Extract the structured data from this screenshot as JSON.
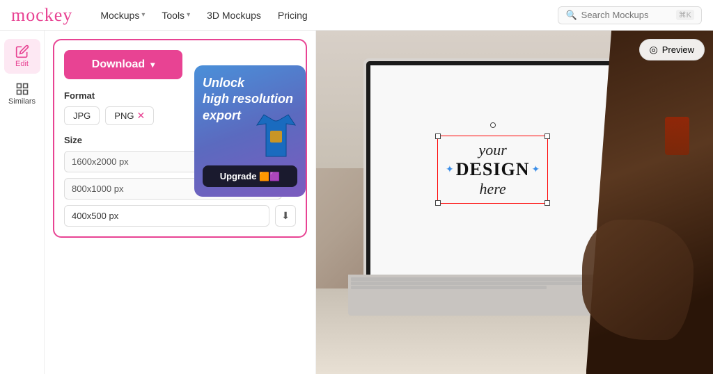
{
  "brand": {
    "name": "mockey"
  },
  "navbar": {
    "items": [
      {
        "label": "Mockups",
        "has_dropdown": true
      },
      {
        "label": "Tools",
        "has_dropdown": true
      },
      {
        "label": "3D Mockups",
        "has_dropdown": false
      },
      {
        "label": "Pricing",
        "has_dropdown": false
      }
    ],
    "search_placeholder": "Search Mockups",
    "search_shortcut": "⌘K"
  },
  "sidebar": {
    "items": [
      {
        "label": "Edit",
        "active": true
      },
      {
        "label": "Similars",
        "active": false
      }
    ]
  },
  "panel": {
    "download_label": "Download",
    "format_section": "Format",
    "format_jpg": "JPG",
    "format_png": "PNG",
    "size_section": "Size",
    "size_large": "1600x2000 px",
    "size_medium": "800x1000 px",
    "size_free": "400x500 px"
  },
  "upgrade_card": {
    "title_line1": "Unlock",
    "title_line2": "high resolution",
    "title_line3": "export",
    "button_label": "Upgrade",
    "emojis": "🟧🟪"
  },
  "canvas": {
    "preview_label": "Preview",
    "design_your": "your",
    "design_main": "DESIGN",
    "design_here": "here"
  }
}
